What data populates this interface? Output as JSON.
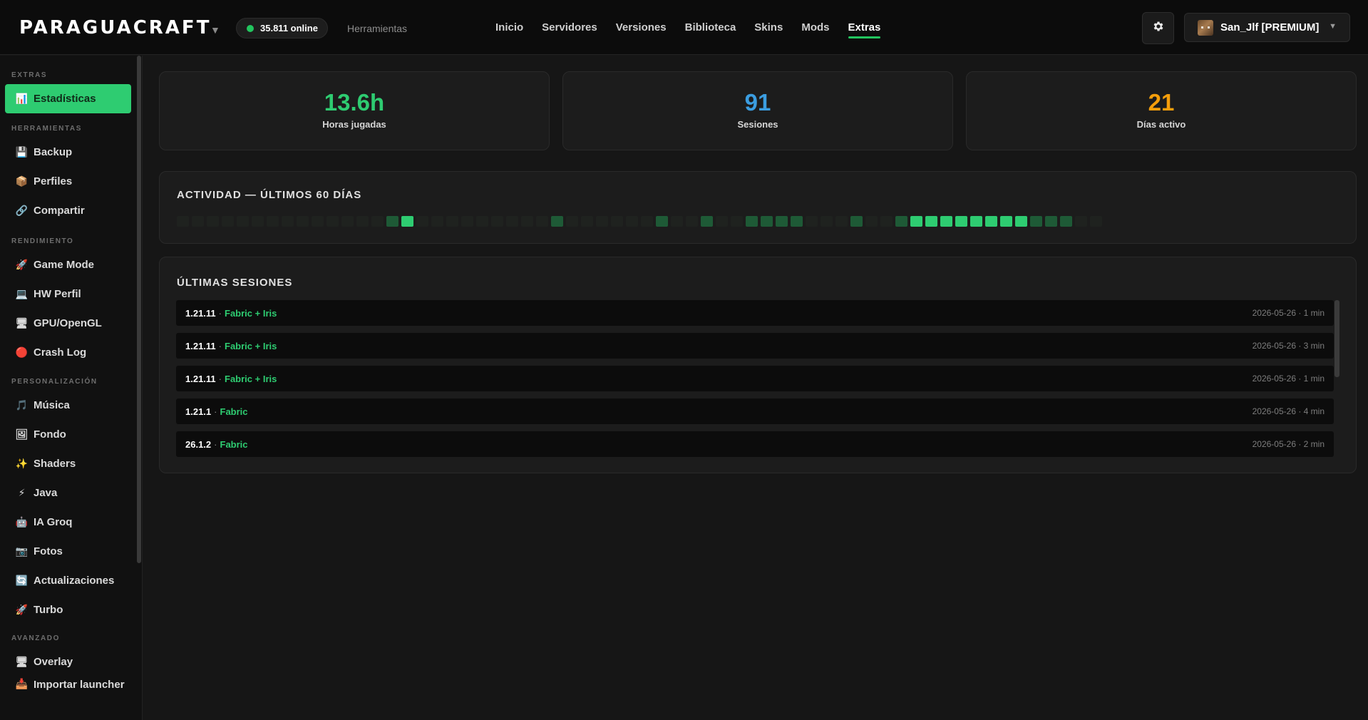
{
  "brand": {
    "name": "PARAGUACRAFT",
    "caret": "▼"
  },
  "online": {
    "text": "35.811 online",
    "dot_color": "#22c55e"
  },
  "tools_link": "Herramientas",
  "nav": [
    "Inicio",
    "Servidores",
    "Versiones",
    "Biblioteca",
    "Skins",
    "Mods",
    "Extras"
  ],
  "nav_active": "Extras",
  "user": {
    "name": "San_Jlf [PREMIUM]",
    "caret": "▼"
  },
  "settings_icon": "gear-icon",
  "sidebar": {
    "sections": [
      {
        "title": "EXTRAS",
        "items": [
          {
            "icon": "📊",
            "icon_name": "chart-icon",
            "label": "Estadísticas",
            "active": true
          }
        ]
      },
      {
        "title": "HERRAMIENTAS",
        "items": [
          {
            "icon": "💾",
            "icon_name": "floppy-disk-icon",
            "label": "Backup"
          },
          {
            "icon": "📦",
            "icon_name": "package-icon",
            "label": "Perfiles"
          },
          {
            "icon": "🔗",
            "icon_name": "link-icon",
            "label": "Compartir"
          }
        ]
      },
      {
        "title": "RENDIMIENTO",
        "items": [
          {
            "icon": "🚀",
            "icon_name": "rocket-icon",
            "label": "Game Mode"
          },
          {
            "icon": "💻",
            "icon_name": "laptop-icon",
            "label": "HW Perfil"
          },
          {
            "icon": "🖥",
            "icon_name": "monitor-icon",
            "label": "GPU/OpenGL"
          },
          {
            "icon": "🔴",
            "icon_name": "red-circle-icon",
            "label": "Crash Log"
          }
        ]
      },
      {
        "title": "PERSONALIZACIÓN",
        "items": [
          {
            "icon": "🎵",
            "icon_name": "music-note-icon",
            "label": "Música"
          },
          {
            "icon": "🖼",
            "icon_name": "picture-icon",
            "label": "Fondo"
          },
          {
            "icon": "✨",
            "icon_name": "sparkles-icon",
            "label": "Shaders"
          },
          {
            "icon": "⚡",
            "icon_name": "lightning-icon",
            "label": "Java"
          },
          {
            "icon": "🤖",
            "icon_name": "robot-icon",
            "label": "IA Groq"
          },
          {
            "icon": "📷",
            "icon_name": "camera-icon",
            "label": "Fotos"
          },
          {
            "icon": "🔄",
            "icon_name": "refresh-icon",
            "label": "Actualizaciones"
          },
          {
            "icon": "🚀",
            "icon_name": "rocket-icon",
            "label": "Turbo"
          }
        ]
      },
      {
        "title": "AVANZADO",
        "items": [
          {
            "icon": "🖥",
            "icon_name": "monitor-icon",
            "label": "Overlay"
          },
          {
            "icon": "📥",
            "icon_name": "inbox-tray-icon",
            "label": "Importar launcher"
          }
        ]
      }
    ]
  },
  "stats": [
    {
      "value": "13.6h",
      "label": "Horas jugadas",
      "color": "#2ecc71"
    },
    {
      "value": "91",
      "label": "Sesiones",
      "color": "#3b9de0"
    },
    {
      "value": "21",
      "label": "Días activo",
      "color": "#f59e0b"
    }
  ],
  "activity": {
    "title": "ACTIVIDAD — ÚLTIMOS 60 DÍAS",
    "days": [
      0,
      0,
      0,
      0,
      0,
      0,
      0,
      0,
      0,
      0,
      0,
      0,
      0,
      0,
      1,
      2,
      0,
      0,
      0,
      0,
      0,
      0,
      0,
      0,
      0,
      1,
      0,
      0,
      0,
      0,
      0,
      0,
      1,
      0,
      0,
      1,
      0,
      0,
      1,
      1,
      1,
      1,
      0,
      0,
      0,
      1,
      0,
      0,
      1,
      2,
      2,
      2,
      2,
      2,
      2,
      2,
      2,
      1,
      1,
      1,
      0,
      0
    ],
    "level_colors": [
      "#1f221f",
      "#1e5a36",
      "#2ecc71"
    ]
  },
  "sessions": {
    "title": "ÚLTIMAS SESIONES",
    "rows": [
      {
        "version": "1.21.11",
        "loader": "Fabric + Iris",
        "meta": "2026-05-26 · 1 min"
      },
      {
        "version": "1.21.11",
        "loader": "Fabric + Iris",
        "meta": "2026-05-26 · 3 min"
      },
      {
        "version": "1.21.11",
        "loader": "Fabric + Iris",
        "meta": "2026-05-26 · 1 min"
      },
      {
        "version": "1.21.1",
        "loader": "Fabric",
        "meta": "2026-05-26 · 4 min"
      },
      {
        "version": "26.1.2",
        "loader": "Fabric",
        "meta": "2026-05-26 · 2 min"
      }
    ]
  }
}
